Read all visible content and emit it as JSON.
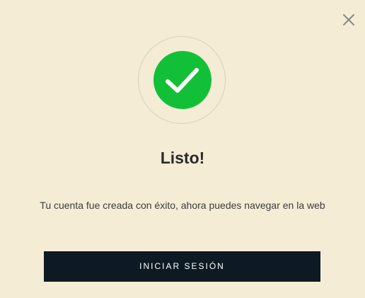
{
  "dialog": {
    "title": "Listo!",
    "message": "Tu cuenta fue creada con éxito, ahora puedes navegar en la web",
    "primary_button_label": "INICIAR SESIÓN",
    "close_icon": "close-icon",
    "status_icon": "success-check-icon"
  },
  "colors": {
    "background": "#f5ecd6",
    "success": "#12c037",
    "button_background": "#0d1a24",
    "button_text": "#ffffff",
    "title_text": "#2b2b2b",
    "message_text": "#3c3c3c",
    "close_icon": "#8a8a8a"
  }
}
